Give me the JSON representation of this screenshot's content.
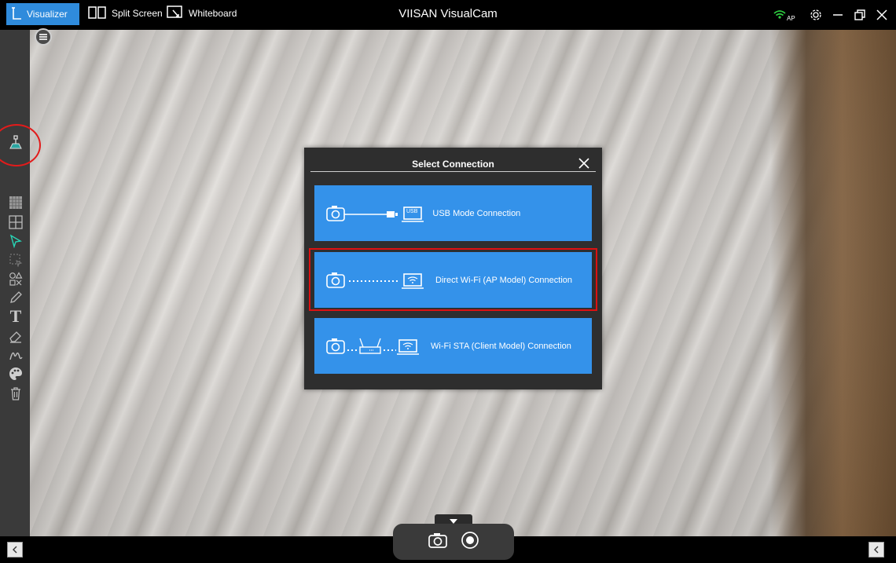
{
  "titlebar": {
    "tabs": [
      {
        "label": "Visualizer",
        "icon": "visualizer-icon",
        "active": true
      },
      {
        "label": "Split Screen",
        "icon": "split-screen-icon"
      },
      {
        "label": "Whiteboard",
        "icon": "whiteboard-icon"
      }
    ],
    "app_title": "VIISAN VisualCam",
    "wifi_badge": "AP"
  },
  "dialog": {
    "title": "Select Connection",
    "options": [
      {
        "label": "USB Mode Connection",
        "usb_tag": "USB"
      },
      {
        "label": "Direct Wi-Fi (AP Model) Connection"
      },
      {
        "label": "Wi-Fi STA (Client Model) Connection"
      }
    ]
  },
  "colors": {
    "accent_blue": "#3492ea",
    "active_tab": "#2f8bdc",
    "highlight_red": "#d11111"
  }
}
